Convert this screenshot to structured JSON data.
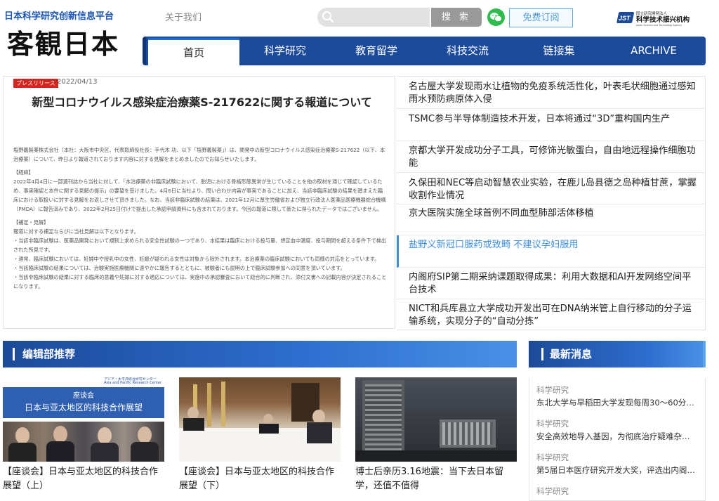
{
  "header": {
    "site_title": "日本科学研究创新信息平台",
    "logo_text": "客観日本",
    "about": "关于我们",
    "search_placeholder": "",
    "search_button": "搜 索",
    "subscribe_button": "免费订阅",
    "jst_line1": "国立研究開発法人",
    "jst_line2": "科学技术振兴机构",
    "jst_line3": "Japan Science and Technology Agency",
    "jst_mark": "JST"
  },
  "nav": {
    "items": [
      "首页",
      "科学研究",
      "教育留学",
      "科技交流",
      "链接集",
      "ARCHIVE"
    ],
    "active_index": 0
  },
  "press": {
    "tag": "プレスリリース",
    "date": "2022/04/13",
    "title": "新型コロナウイルス感染症治療薬S-217622に関する報道について",
    "paragraphs": [
      "塩野義製薬株式会社（本社：大阪市中央区、代表取締役社長：手代木 功、以下「塩野義製薬」）は、関発中の新型コロナウイルス感染症治療薬S-217622（以下、本治療薬）について、昨日より報道されております内容に対する見解をまとめましたのでお知らせいたします。",
      "【経緯】",
      "2022年4月4日に一部週刊誌から当社に対して、「本治療薬の非臨床試験において、胎児における骨格形態異常が生じていることを他の取材を通じて確認しているため、事実確認と本件に関する見解の提示」の要望を受けました。4月6日に当社より、問い合わせ内容が事実であることに加え、当該非臨床試験の結果を踏まえた臨床における取扱いに対する見解をお返しさせて頂きました。なお、当該非臨床試験の結果は、2021年12月に厚生労働省および独立行政法人医薬品医療機器総合機構（PMDA）に報告済みであり、2022年2月25日付けで提出した承認申請資料にも含まれております。今回の報道に際して新たに得られたデータではございません。",
      "【補足・見解】",
      "報道に対する補足ならびに当社見解は以下となります。",
      "・当該非臨床試験は、医薬品開発において規制上求められる安全性試験の一つであり、本結果は臨床における投与量、想定血中濃度、投与期間を超える条件下で検出された所見です。",
      "・通常、臨床試験においては、妊婦中や授乳中の女性、妊娠が疑われる女性は対象から除外されます。本治療薬の臨床試験においても同様の対応をとっています。",
      "・当該臨床試験の結果については、治験実施医療機関に速やかに報告するとともに、被験者にも説明の上で臨床試験参加への同意を頂いています。",
      "・当該非臨床試験の結果に対する臨床的意義や妊婦に対する適応については、実施中の承認審査において総合的に判断され、添付文書への記載内容が決定されることになります。"
    ]
  },
  "headlines": [
    "名古屋大学发现雨水让植物的免疫系统活性化，叶表毛状细胞通过感知雨水预防病原体入侵",
    "TSMC参与半导体制造技术开发，日本将通过“3D”重构国内生产",
    "京都大学开发成功分子工具，可修饰光敏蛋白，自由地远程操作细胞功能",
    "久保田和NEC等启动智慧农业实验，在鹿儿岛县德之岛种植甘蔗，掌握收割作业情况",
    "京大医院实施全球首例不同血型肺部活体移植",
    "盐野义新冠口服药或致畸 不建议孕妇服用",
    "内阁府SIP第二期采纳课题取得成果：利用大数据和AI开发网络空间平台技术",
    "NICT和兵库县立大学成功开发出可在DNA纳米管上自行移动的分子运输系统，实现分子的“自动分拣”"
  ],
  "headline_active_index": 5,
  "sections": {
    "editor_pick": "编辑部推荐",
    "latest_news": "最新消息"
  },
  "cards": [
    {
      "banner_org": "アジア・太平洋総合研究センター\nAsia and Pacific Research Center",
      "banner_line1": "座谈会",
      "banner_line2": "日本与亚太地区的科技合作展望",
      "caption": "【座谈会】日本与亚太地区的科技合作展望（上）"
    },
    {
      "caption": "【座谈会】日本与亚太地区的科技合作展望（下）"
    },
    {
      "caption": "博士后亲历3.16地震：当下去日本留学，还值不值得"
    }
  ],
  "latest": [
    {
      "category": "科学研究",
      "text": "东北大学与早稻田大学发现每周30～60分…"
    },
    {
      "category": "科学研究",
      "text": "安全高效地导入基因，为彻底治疗疑难杂…"
    },
    {
      "category": "科学研究",
      "text": "第5届日本医疗研究开发大奖，评选出内阁…"
    },
    {
      "category": "科学研究",
      "text": ""
    }
  ],
  "colors": {
    "brand_blue": "#1c4a9a",
    "accent_blue": "#3d8ed9",
    "press_red": "#d3251e",
    "wechat_green": "#2dbd4c"
  }
}
